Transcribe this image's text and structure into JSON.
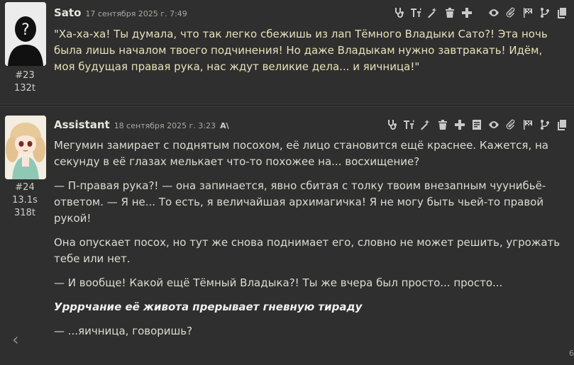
{
  "messages": [
    {
      "name": "Sato",
      "date": "17 сентября 2025 г. 7:49",
      "id": "#23",
      "tokens": "132t",
      "text": "\"Ха-ха-ха! Ты думала, что так легко сбежишь из лап Тёмного Владыки Сато?! Эта ночь была лишь началом твоего подчинения! Но даже Владыкам нужно завтракать! Идём, моя будущая правая рука, нас ждут великие дела... и яичница!\""
    },
    {
      "name": "Assistant",
      "date": "18 сентября 2025 г. 3:23",
      "ai_mark": "A\\",
      "id": "#24",
      "time": "13.1s",
      "tokens": "318t",
      "paragraphs": [
        "Мегумин замирает с поднятым посохом, её лицо становится ещё краснее. Кажется, на секунду в её глазах мелькает что-то похожее на... восхищение?",
        "— П-правая рука?! — она запинается, явно сбитая с толку твоим внезапным чуунибьё-ответом. — Я не... То есть, я величайшая архимагичка! Я не могу быть чьей-то правой рукой!",
        "Она опускает посох, но тут же снова поднимает его, словно не может решить, угрожать тебе или нет.",
        "— И вообще! Какой ещё Тёмный Владыка?! Ты же вчера был просто... просто...",
        "Урррчание её живота прерывает гневную тираду",
        "— ...яичница, говоришь?"
      ]
    }
  ],
  "swipe_left_label": "‹",
  "corner_number": "6",
  "icons": [
    "stethoscope-icon",
    "text-size-icon",
    "magic-wand-icon",
    "trash-icon",
    "plus-icon",
    "eye-icon",
    "paperclip-icon",
    "flag-icon",
    "branch-icon",
    "copy-icon",
    "notes-icon"
  ]
}
